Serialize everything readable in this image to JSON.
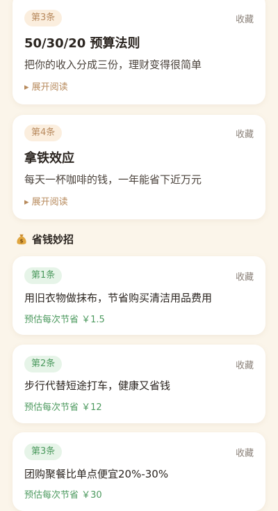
{
  "articles": [
    {
      "badge": "第3条",
      "fav": "收藏",
      "title": "50/30/20 预算法则",
      "desc": "把你的收入分成三份，理财变得很简单",
      "expand": "▸ 展开阅读"
    },
    {
      "badge": "第4条",
      "fav": "收藏",
      "title": "拿铁效应",
      "desc": "每天一杯咖啡的钱，一年能省下近万元",
      "expand": "▸ 展开阅读"
    }
  ],
  "section": {
    "icon": "money-bag-icon",
    "title": "省钱妙招"
  },
  "tips": [
    {
      "badge": "第1条",
      "fav": "收藏",
      "text": "用旧衣物做抹布，节省购买清洁用品费用",
      "saving": "预估每次节省 ￥1.5"
    },
    {
      "badge": "第2条",
      "fav": "收藏",
      "text": "步行代替短途打车，健康又省钱",
      "saving": "预估每次节省 ￥12"
    },
    {
      "badge": "第3条",
      "fav": "收藏",
      "text": "团购聚餐比单点便宜20%-30%",
      "saving": "预估每次节省 ￥30"
    }
  ],
  "colors": {
    "accent_orange": "#b88a5e",
    "accent_green": "#4d9a5f",
    "background": "#fbf5ea"
  }
}
